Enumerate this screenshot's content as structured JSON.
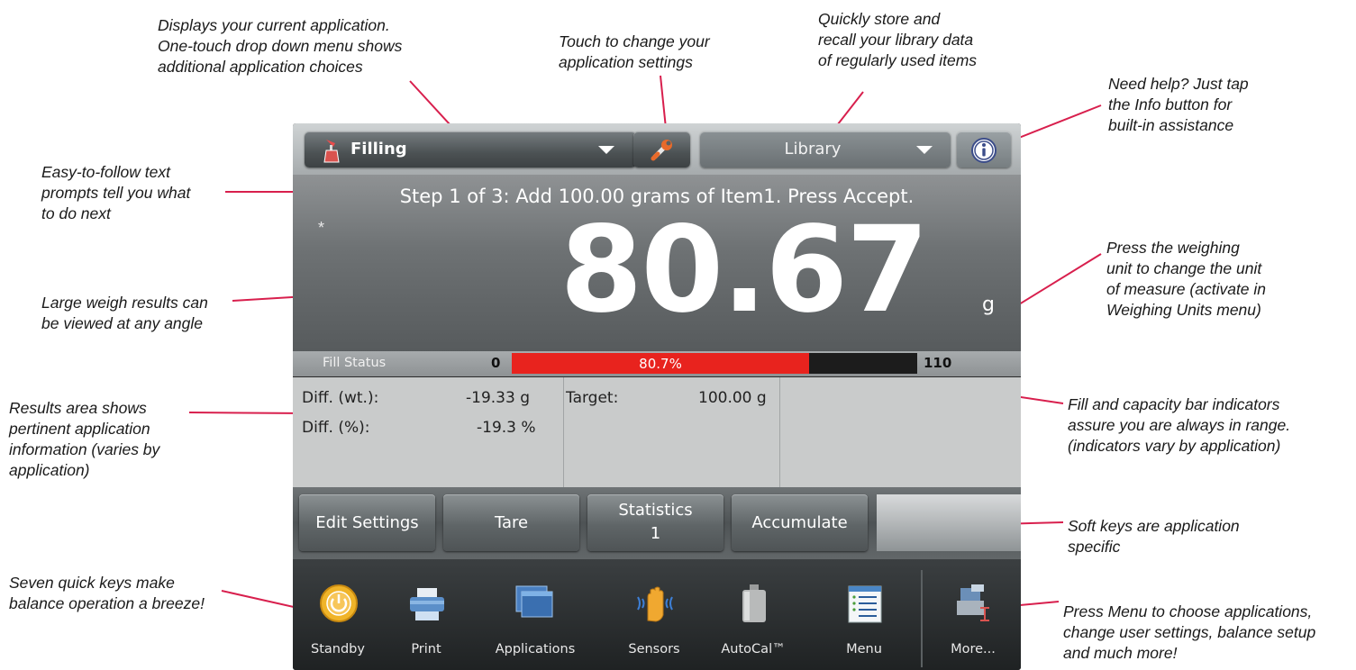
{
  "annotations": {
    "app_menu": "Displays your current application.\nOne-touch drop down menu shows\nadditional application choices",
    "settings": "Touch to change your\napplication settings",
    "library": "Quickly store and\nrecall your library data\nof regularly used items",
    "info": "Need help?  Just tap\nthe Info button for\nbuilt-in assistance",
    "prompt": "Easy-to-follow text\nprompts tell you what\nto do next",
    "weight": "Large weigh results can\nbe viewed at any angle",
    "unit": "Press the weighing\nunit to change the unit\nof measure (activate in\nWeighing Units menu)",
    "results": "Results area shows\npertinent application\ninformation (varies by\napplication)",
    "fill": "Fill and capacity bar indicators\nassure you are always in range.\n(indicators vary by application)",
    "softkeys": "Soft keys are application\nspecific",
    "quickkeys": "Seven quick keys make\nbalance operation a breeze!",
    "menu": "Press Menu to choose applications,\nchange user settings, balance setup\nand much more!"
  },
  "topbar": {
    "application": "Filling",
    "library": "Library"
  },
  "display": {
    "prompt": "Step 1 of 3: Add 100.00 grams of Item1.  Press Accept.",
    "stable_marker": "*",
    "weight": "80.67",
    "unit": "g"
  },
  "fill_status": {
    "label": "Fill Status",
    "min": "0",
    "max": "110",
    "percent_text": "80.7%",
    "fraction_of_scale": 0.733
  },
  "results": {
    "diff_wt_label": "Diff. (wt.):",
    "diff_wt_value": "-19.33 g",
    "diff_pct_label": "Diff. (%):",
    "diff_pct_value": "-19.3 %",
    "target_label": "Target:",
    "target_value": "100.00 g"
  },
  "softkeys": {
    "edit_settings": "Edit Settings",
    "tare": "Tare",
    "statistics": "Statistics",
    "statistics_count": "1",
    "accumulate": "Accumulate"
  },
  "quickkeys": {
    "standby": "Standby",
    "print": "Print",
    "applications": "Applications",
    "sensors": "Sensors",
    "autocal": "AutoCal™",
    "menu": "Menu",
    "more": "More..."
  },
  "colors": {
    "fill_bar": "#e8231e",
    "leader_lines": "#d81f4d",
    "standby_icon": "#f0b429"
  }
}
